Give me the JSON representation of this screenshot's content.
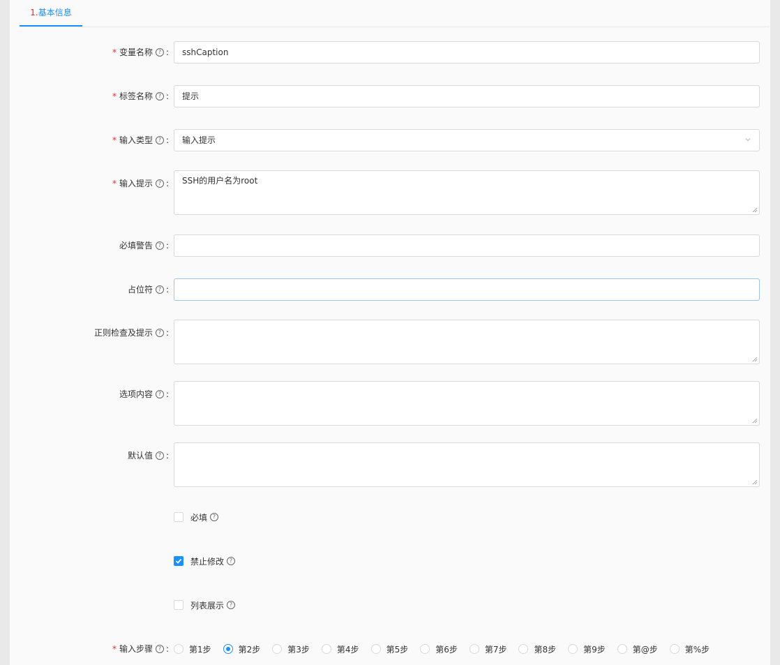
{
  "tab": {
    "num": "1.",
    "label": "基本信息"
  },
  "fields": {
    "var_name": {
      "label": "变量名称",
      "value": "sshCaption"
    },
    "tag_name": {
      "label": "标签名称",
      "value": "提示"
    },
    "input_type": {
      "label": "输入类型",
      "value": "输入提示"
    },
    "input_hint": {
      "label": "输入提示",
      "value": "SSH的用户名为root"
    },
    "required_warning": {
      "label": "必填警告",
      "value": ""
    },
    "placeholder": {
      "label": "占位符",
      "value": ""
    },
    "regex": {
      "label": "正则检查及提示",
      "value": ""
    },
    "options": {
      "label": "选项内容",
      "value": ""
    },
    "default_value": {
      "label": "默认值",
      "value": ""
    }
  },
  "checks": {
    "required": {
      "label": "必填",
      "checked": false
    },
    "no_modify": {
      "label": "禁止修改",
      "checked": true
    },
    "list_show": {
      "label": "列表展示",
      "checked": false
    }
  },
  "steps": {
    "label": "输入步骤",
    "options": [
      "第1步",
      "第2步",
      "第3步",
      "第4步",
      "第5步",
      "第6步",
      "第7步",
      "第8步",
      "第9步",
      "第@步",
      "第%步"
    ],
    "selected": "第2步"
  },
  "colon": ":",
  "help_glyph": "?",
  "required_mark": "*",
  "colors": {
    "accent": "#1890ff",
    "required": "#f5222d"
  }
}
